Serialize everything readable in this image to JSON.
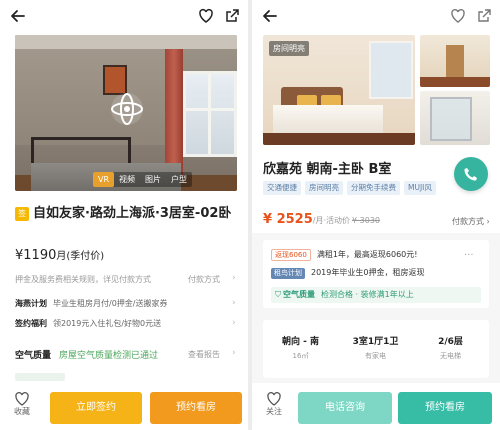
{
  "left": {
    "photo_tabs": [
      "VR",
      "视频",
      "图片",
      "户型"
    ],
    "badge": "签",
    "title": "自如友家·路劲上海派·3居室-02卧",
    "price": "¥1190",
    "price_unit": "月(季付价)",
    "deposit_text": "押金及服务费相关规则，详见付款方式",
    "pay_label": "付款方式",
    "perks": [
      {
        "label": "海燕计划",
        "text": "毕业生租房月付/0押金/送搬家券"
      },
      {
        "label": "签约福利",
        "text": "领2019元入住礼包/好物0元送"
      }
    ],
    "air_label": "空气质量",
    "air_status": "房屋空气质量检测已通过",
    "air_report": "查看报告",
    "fav_label": "收藏",
    "sign_button": "立即签约",
    "visit_button": "预约看房",
    "colors": {
      "sign": "#f5b318",
      "visit": "#f29a1e"
    }
  },
  "right": {
    "photo_tag": "房间明亮",
    "title": "欣嘉苑 朝南-主卧 B室",
    "tags": [
      "交通便捷",
      "房间明亮",
      "分期免手续费",
      "MUJI风"
    ],
    "price": "¥ 2525",
    "price_suffix": "/月·活动价",
    "price_old": "¥ 3030",
    "pay_label": "付款方式",
    "promos": [
      {
        "pill": "返现6060",
        "text": "满租1年，最高返现6060元!"
      },
      {
        "pill": "租鸟计划",
        "text": "2019年毕业生0押金，租房返现"
      }
    ],
    "air_label": "空气质量",
    "air_status": "检测合格 · 装修满1年以上",
    "specs": [
      {
        "value": "朝向 - 南",
        "sub": "16㎡"
      },
      {
        "value": "3室1厅1卫",
        "sub": "有家电"
      },
      {
        "value": "2/6层",
        "sub": "无电梯"
      }
    ],
    "fav_label": "关注",
    "call_button": "电话咨询",
    "visit_button": "预约看房",
    "colors": {
      "call": "#7dd7c4",
      "visit": "#37bca6",
      "price": "#e8521b"
    }
  }
}
